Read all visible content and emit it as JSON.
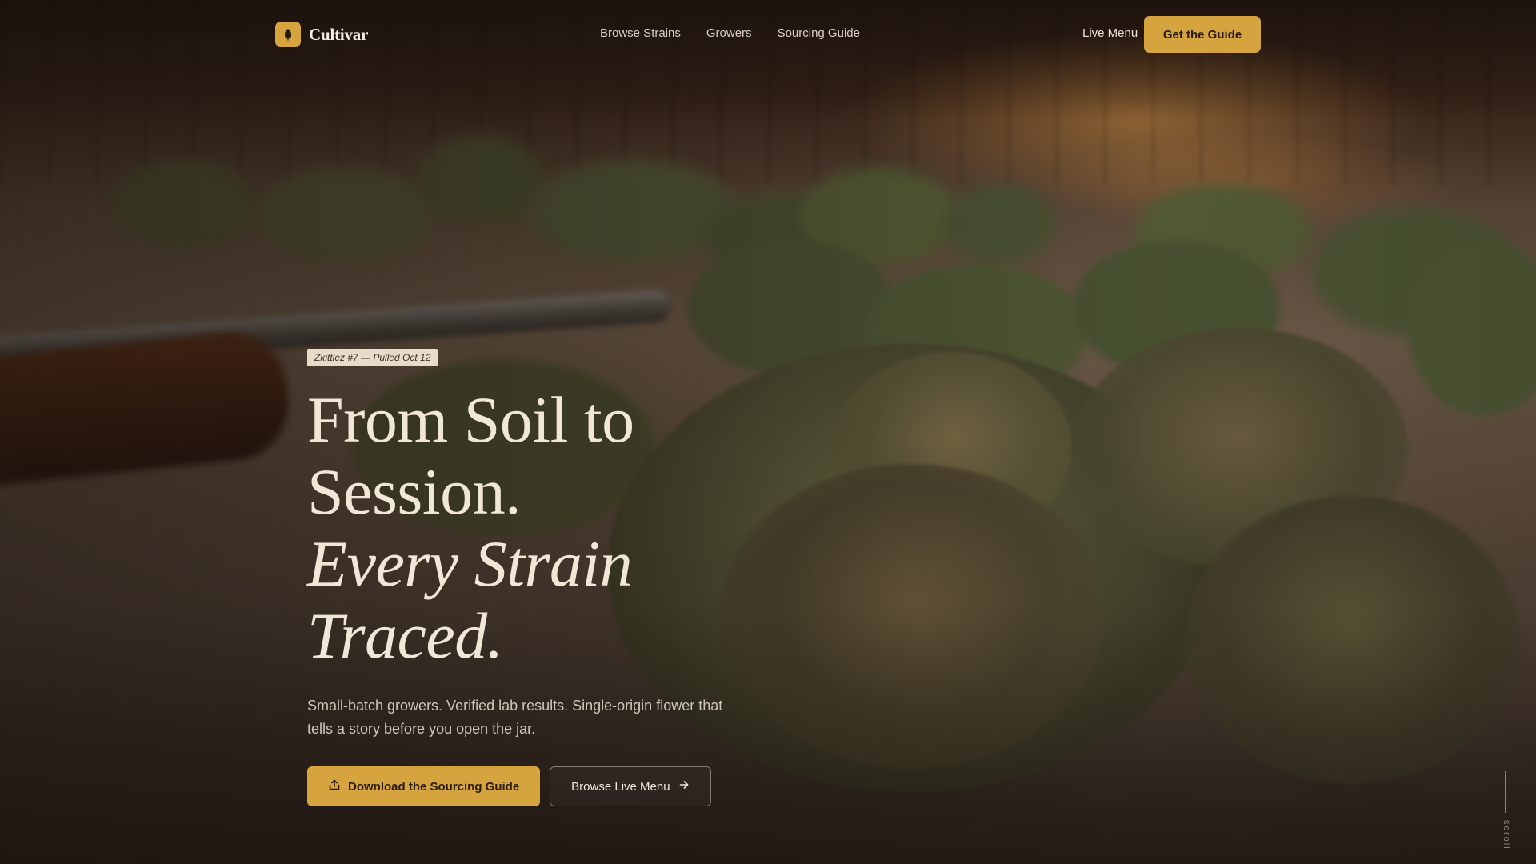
{
  "brand": {
    "name": "Cultivar",
    "accent": "#d5a43f"
  },
  "nav": {
    "items": [
      {
        "label": "Browse Strains"
      },
      {
        "label": "Growers"
      },
      {
        "label": "Sourcing Guide"
      }
    ],
    "live_menu": "Live Menu",
    "cta": "Get the Guide"
  },
  "hero": {
    "tag": "Zkittlez #7 — Pulled Oct 12",
    "headline_line1": "From Soil to",
    "headline_line2": "Session.",
    "headline_italic1": "Every Strain",
    "headline_italic2": "Traced.",
    "subtitle": "Small-batch growers. Verified lab results. Single-origin flower that tells a story before you open the jar.",
    "primary_cta": "Download the Sourcing Guide",
    "secondary_cta": "Browse Live Menu"
  },
  "scroll_label": "scroll",
  "icons": {
    "brand": "leaf-icon",
    "primary_cta": "download-icon",
    "secondary_cta": "arrow-right-icon"
  }
}
